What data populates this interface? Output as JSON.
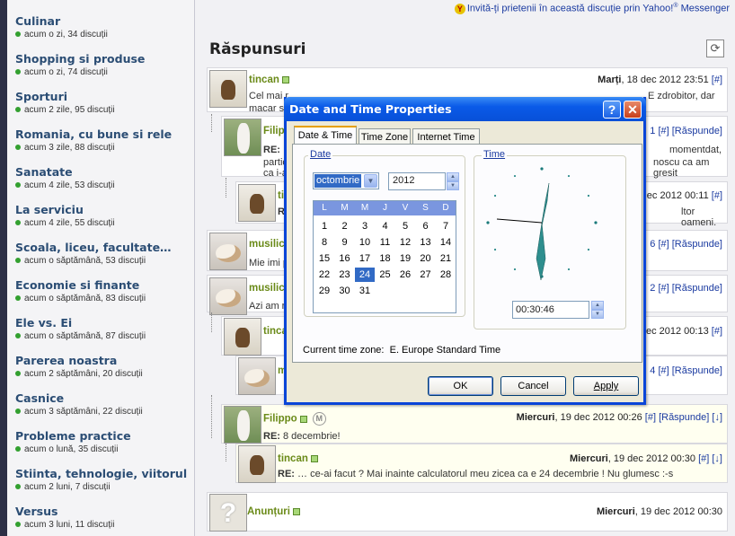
{
  "sidebar": {
    "categories": [
      {
        "title": "Culinar",
        "sub": "acum o zi, 34 discuții"
      },
      {
        "title": "Shopping si produse",
        "sub": "acum o zi, 74 discuții"
      },
      {
        "title": "Sporturi",
        "sub": "acum 2 zile, 95 discuții"
      },
      {
        "title": "Romania, cu bune si rele",
        "sub": "acum 3 zile, 88 discuții"
      },
      {
        "title": "Sanatate",
        "sub": "acum 4 zile, 53 discuții"
      },
      {
        "title": "La serviciu",
        "sub": "acum 4 zile, 55 discuții"
      },
      {
        "title": "Scoala, liceu, facultate…",
        "sub": "acum o săptămână, 53 discuții"
      },
      {
        "title": "Economie si finante",
        "sub": "acum o săptămână, 83 discuții"
      },
      {
        "title": "Ele vs. Ei",
        "sub": "acum o săptămână, 87 discuții"
      },
      {
        "title": "Parerea noastra",
        "sub": "acum 2 săptămâni, 20 discuții"
      },
      {
        "title": "Casnice",
        "sub": "acum 3 săptămâni, 22 discuții"
      },
      {
        "title": "Probleme practice",
        "sub": "acum o lună, 35 discuții"
      },
      {
        "title": "Stiinta, tehnologie, viitorul",
        "sub": "acum 2 luni, 7 discuții"
      },
      {
        "title": "Versus",
        "sub": "acum 3 luni, 11 discuții"
      }
    ]
  },
  "header": {
    "invite": "Invită-ți prietenii în această discuție prin Yahoo!",
    "messenger": "Messenger",
    "title": "Răspunsuri"
  },
  "posts": {
    "p1": {
      "user": "tincan",
      "day": "Marți",
      "date": ", 18 dec 2012 23:51",
      "link": "[#]",
      "text1": "Cel mai r",
      "text1b": "E zdrobitor, dar",
      "text2": "macar sa"
    },
    "p2": {
      "user": "Filipp",
      "links": "1 [#] [Răspunde]",
      "re": "RE:",
      "l1": "momentdat,",
      "l2": "partic",
      "l2b": "noscu ca am gresit",
      "l3": "ca i-a"
    },
    "p3": {
      "user": "tin",
      "date": "2 dec 2012 00:11",
      "link": "[#]",
      "re": "R",
      "text": "ltor oameni."
    },
    "p4": {
      "user": "musilic",
      "links": "6 [#] [Răspunde]",
      "text": "Mie imi p"
    },
    "p5": {
      "user": "musilic",
      "links": "2 [#] [Răspunde]",
      "text": "Azi am re"
    },
    "p6": {
      "user": "tinca",
      "date": "2 dec 2012 00:13",
      "link": "[#]"
    },
    "p7": {
      "user": "m",
      "links": "4 [#] [Răspunde]"
    },
    "p8": {
      "user": "Filippo",
      "badge": "M",
      "day": "Miercuri",
      "date": ", 19 dec 2012 00:26",
      "links": "[#] [Răspunde] [↓]",
      "re": "RE:",
      "text": " 8 decembrie!"
    },
    "p9": {
      "user": "tincan",
      "day": "Miercuri",
      "date": ", 19 dec 2012 00:30",
      "links": "[#] [↓]",
      "re": "RE:",
      "text": " … ce-ai facut ? Mai inainte calculatorul meu zicea ca e 24 decembrie ! Nu glumesc :-s"
    },
    "p10": {
      "user": "Anunțuri",
      "avatar": "?",
      "day": "Miercuri",
      "date": ", 19 dec 2012 00:30"
    }
  },
  "dialog": {
    "title": "Date and Time Properties",
    "help": "?",
    "close": "✕",
    "tabs": [
      "Date & Time",
      "Time Zone",
      "Internet Time"
    ],
    "date_group": "Date",
    "time_group": "Time",
    "month": "octombrie",
    "year": "2012",
    "weekdays": [
      "L",
      "M",
      "M",
      "J",
      "V",
      "S",
      "D"
    ],
    "days": [
      [
        "",
        "1",
        "2",
        "3",
        "4",
        "5",
        "6",
        "7"
      ],
      [
        "8",
        "9",
        "10",
        "11",
        "12",
        "13",
        "14"
      ],
      [
        "15",
        "16",
        "17",
        "18",
        "19",
        "20",
        "21"
      ],
      [
        "22",
        "23",
        "24",
        "25",
        "26",
        "27",
        "28"
      ],
      [
        "29",
        "30",
        "31"
      ]
    ],
    "selected_day": "24",
    "time": "00:30:46",
    "timezone_label": "Current time zone:",
    "timezone": "E. Europe Standard Time",
    "ok": "OK",
    "cancel": "Cancel",
    "apply": "Apply"
  },
  "icons": {
    "refresh": "refresh-icon",
    "yahoo": "yahoo-messenger-icon",
    "online": "online-status-icon",
    "dropdown": "chevron-down-icon",
    "spin": "spin-arrows-icon"
  },
  "colors": {
    "sidebar_title": "#2b4d74",
    "username": "#6a8a18",
    "link": "#1a3aa0",
    "xp_title": "#0a5ae8",
    "selected": "#316ac5"
  }
}
